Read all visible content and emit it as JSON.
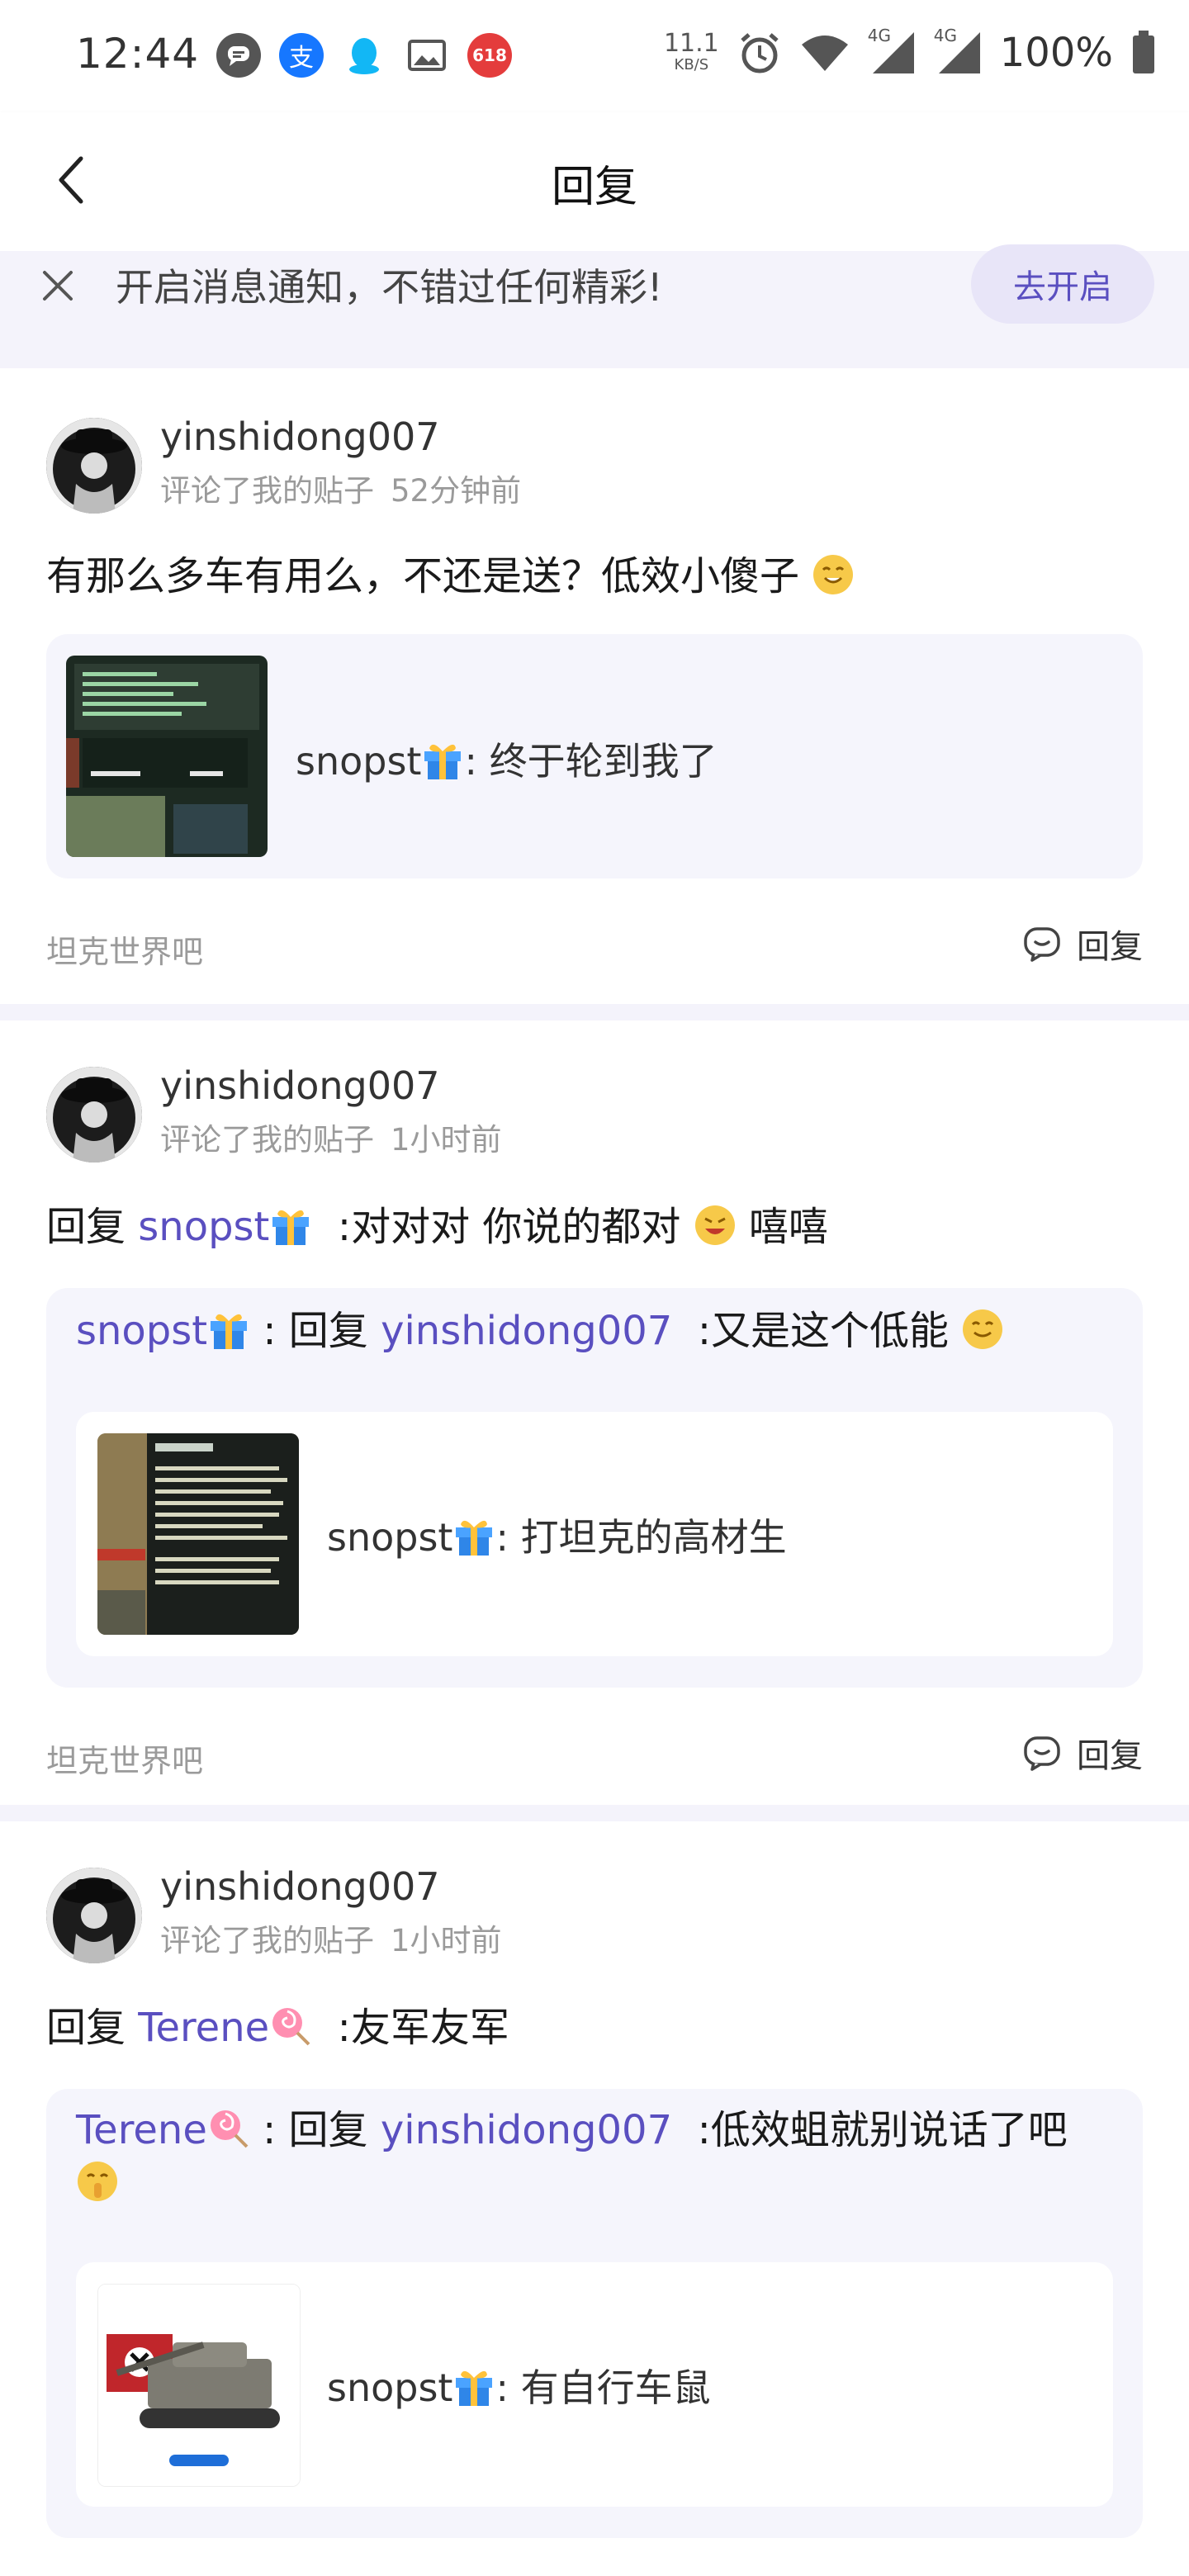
{
  "status_bar": {
    "time": "12:44",
    "speed_value": "11.1",
    "speed_unit": "KB/S",
    "net1": "4G",
    "net2": "4G",
    "battery": "100%",
    "badge": "618"
  },
  "header": {
    "title": "回复"
  },
  "notice": {
    "text": "开启消息通知，不错过任何精彩!",
    "button": "去开启"
  },
  "cards": [
    {
      "username": "yinshidong007",
      "action": "评论了我的贴子",
      "time": "52分钟前",
      "content": "有那么多车有用么，不还是送？低效小傻子",
      "quoted": {
        "author": "snopst",
        "text": ": 终于轮到我了"
      },
      "forum": "坦克世界吧",
      "reply_label": "回复"
    },
    {
      "username": "yinshidong007",
      "action": "评论了我的贴子",
      "time": "1小时前",
      "content_prefix": "回复",
      "content_target": "snopst",
      "content_text": ":对对对 你说的都对",
      "content_suffix": "嘻嘻",
      "reply_author": "snopst",
      "reply_mid": ": 回复",
      "reply_target": "yinshidong007",
      "reply_text": ":又是这个低能",
      "quoted": {
        "author": "snopst",
        "text": ": 打坦克的高材生"
      },
      "forum": "坦克世界吧",
      "reply_label": "回复"
    },
    {
      "username": "yinshidong007",
      "action": "评论了我的贴子",
      "time": "1小时前",
      "content_prefix": "回复",
      "content_target": "Terene",
      "content_text": ":友军友军",
      "reply_author": "Terene",
      "reply_mid": ": 回复",
      "reply_target": "yinshidong007",
      "reply_text": ":低效蛆就别说话了吧",
      "quoted": {
        "author": "snopst",
        "text": ": 有自行车鼠"
      }
    }
  ]
}
